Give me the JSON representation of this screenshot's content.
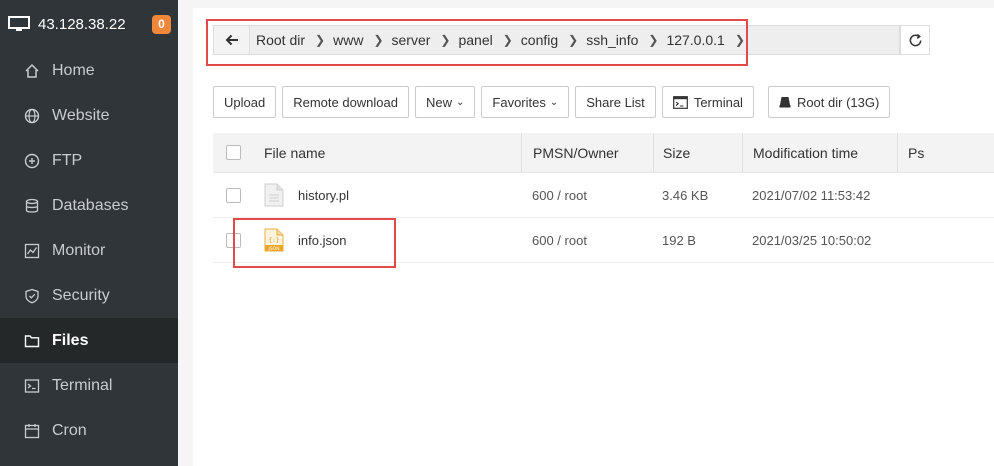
{
  "header": {
    "ip": "43.128.38.22",
    "badge_count": "0"
  },
  "sidebar": {
    "items": [
      {
        "label": "Home",
        "icon": "home-icon",
        "active": false
      },
      {
        "label": "Website",
        "icon": "globe-icon",
        "active": false
      },
      {
        "label": "FTP",
        "icon": "ftp-icon",
        "active": false
      },
      {
        "label": "Databases",
        "icon": "database-icon",
        "active": false
      },
      {
        "label": "Monitor",
        "icon": "monitor-chart-icon",
        "active": false
      },
      {
        "label": "Security",
        "icon": "shield-icon",
        "active": false
      },
      {
        "label": "Files",
        "icon": "folder-icon",
        "active": true
      },
      {
        "label": "Terminal",
        "icon": "terminal-icon",
        "active": false
      },
      {
        "label": "Cron",
        "icon": "calendar-icon",
        "active": false
      }
    ]
  },
  "path": {
    "crumbs": [
      "Root dir",
      "www",
      "server",
      "panel",
      "config",
      "ssh_info",
      "127.0.0.1"
    ]
  },
  "toolbar": {
    "upload": "Upload",
    "remote_download": "Remote download",
    "new": "New",
    "favorites": "Favorites",
    "share_list": "Share List",
    "terminal": "Terminal",
    "root_dir": "Root dir (13G)"
  },
  "table": {
    "headers": {
      "name": "File name",
      "perm": "PMSN/Owner",
      "size": "Size",
      "mtime": "Modification time",
      "ps": "Ps"
    },
    "rows": [
      {
        "name": "history.pl",
        "perm": "600 / root",
        "size": "3.46 KB",
        "mtime": "2021/07/02 11:53:42",
        "ps": "",
        "icon": "file-icon"
      },
      {
        "name": "info.json",
        "perm": "600 / root",
        "size": "192 B",
        "mtime": "2021/03/25 10:50:02",
        "ps": "",
        "icon": "json-file-icon"
      }
    ]
  },
  "colors": {
    "sidebar_bg": "#2f3538",
    "active_bg": "#242829",
    "badge": "#f0873a",
    "highlight": "#e04a4a"
  }
}
